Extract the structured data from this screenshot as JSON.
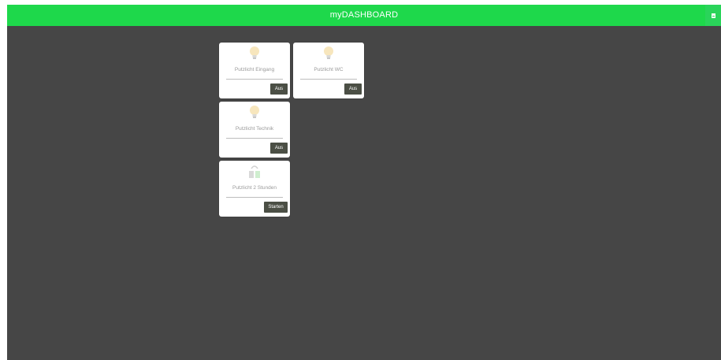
{
  "header": {
    "title": "myDASHBOARD"
  },
  "colors": {
    "accent": "#1ed84b",
    "background": "#464646",
    "card": "#ffffff",
    "button": "#4b4f45"
  },
  "cards": [
    {
      "icon": "light-bulb-icon",
      "label": "Putzlicht Eingang",
      "button": "Aus"
    },
    {
      "icon": "light-bulb-icon",
      "label": "Putzlicht WC",
      "button": "Aus"
    },
    {
      "icon": "light-bulb-icon",
      "label": "Putzlicht Technik",
      "button": "Aus"
    },
    {
      "icon": "scene-icon",
      "label": "Putzlicht 2 Stunden",
      "button": "Starten"
    }
  ]
}
